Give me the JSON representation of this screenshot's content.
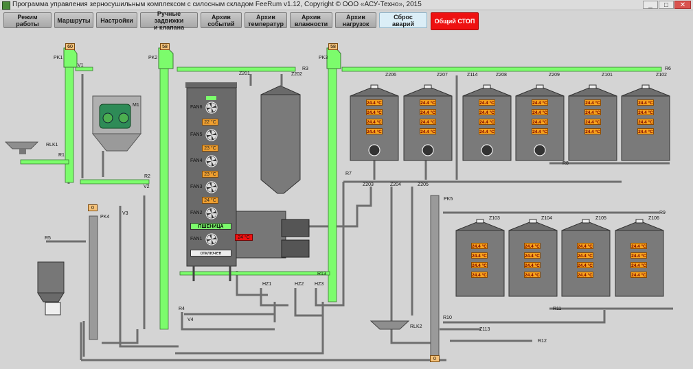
{
  "window": {
    "title": "Программа управления зерносушильным комплексом с силосным складом FeeRum v1.12, Copyright © ООО «АСУ-Техно», 2015",
    "minimize": "_",
    "maximize": "□",
    "close": "✕"
  },
  "toolbar": {
    "mode": "Режим работы",
    "routes": "Маршруты",
    "settings": "Настройки",
    "manual": "Ручные задвижки\nи клапана",
    "events": "Архив\nсобытий",
    "temps": "Архив\nтемператур",
    "humidity": "Архив\nвлажности",
    "loads": "Архив\nнагрузок",
    "reset": "Сброс аварий",
    "stop": "Общий СТОП"
  },
  "elevators": {
    "pk1": {
      "label": "PK1",
      "value": "60"
    },
    "pk2": {
      "label": "PK2",
      "value": "58"
    },
    "pk3": {
      "label": "PK3",
      "value": "58"
    },
    "pk4": {
      "label": "PK4",
      "value": "0"
    },
    "pk5": {
      "label": "PK5",
      "value": "0"
    }
  },
  "dryer": {
    "fans": [
      "FAN6",
      "FAN5",
      "FAN4",
      "FAN3",
      "FAN2",
      "FAN1"
    ],
    "zone_temps": [
      "22 °C",
      "23 °C",
      "23 °C",
      "24 °C"
    ],
    "burner_temp": "24 °C",
    "grain": "ПШЕНИЦА",
    "status": "отключен"
  },
  "silos_top": [
    {
      "id": "Z206",
      "temps": [
        "24.4 °C",
        "24.4 °C",
        "24.4 °C",
        "24.4 °C"
      ]
    },
    {
      "id": "Z207",
      "temps": [
        "24.4 °C",
        "24.4 °C",
        "24.4 °C",
        "24.4 °C"
      ]
    },
    {
      "id": "Z114/Z208",
      "temps": [
        "24.4 °C",
        "24.4 °C",
        "24.4 °C",
        "24.4 °C"
      ]
    },
    {
      "id": "Z209",
      "temps": [
        "24.4 °C",
        "24.4 °C",
        "24.4 °C",
        "24.4 °C"
      ]
    },
    {
      "id": "Z101",
      "temps": [
        "24.4 °C",
        "24.4 °C",
        "24.4 °C",
        "24.4 °C"
      ]
    },
    {
      "id": "Z102",
      "temps": [
        "24.4 °C",
        "24.4 °C",
        "24.4 °C",
        "24.4 °C"
      ]
    }
  ],
  "silos_bottom": [
    {
      "id": "Z103",
      "temps": [
        "24.4 °C",
        "24.4 °C",
        "24.4 °C",
        "24.4 °C"
      ]
    },
    {
      "id": "Z104",
      "temps": [
        "24.4 °C",
        "24.4 °C",
        "24.4 °C",
        "24.4 °C"
      ]
    },
    {
      "id": "Z105",
      "temps": [
        "24.4 °C",
        "24.4 °C",
        "24.4 °C",
        "24.4 °C"
      ]
    },
    {
      "id": "Z106",
      "temps": [
        "24.4 °C",
        "24.4 °C",
        "24.4 °C",
        "24.4 °C"
      ]
    }
  ],
  "labels": {
    "rlk1": "RLK1",
    "r1": "R1",
    "v1": "V1",
    "m1": "M1",
    "r2": "R2",
    "v2": "V2",
    "v3": "V3",
    "r5": "R5",
    "r3": "R3",
    "z201": "Z201",
    "z202": "Z202",
    "r4": "R4",
    "v4": "V4",
    "r13": "R13",
    "hz1": "HZ1",
    "hz2": "HZ2",
    "hz3": "HZ3",
    "r6": "R6",
    "r7": "R7",
    "r8": "R8",
    "z203": "Z203",
    "z204": "Z204",
    "z205": "Z205",
    "r9": "R9",
    "r10": "R10",
    "r11": "R11",
    "r12": "R12",
    "z113": "Z113",
    "rlk2": "RLK2",
    "z114": "Z114",
    "z208": "Z208",
    "z206": "Z206",
    "z207": "Z207",
    "z209": "Z209",
    "z101": "Z101",
    "z102": "Z102",
    "z103": "Z103",
    "z104": "Z104",
    "z105": "Z105",
    "z106": "Z106"
  },
  "colors": {
    "active": "#7cfc6c",
    "temp_box": "#f7a21c",
    "alarm": "#ee1111",
    "stop_button": "#ee1111",
    "reset_button": "#dbeef7"
  }
}
